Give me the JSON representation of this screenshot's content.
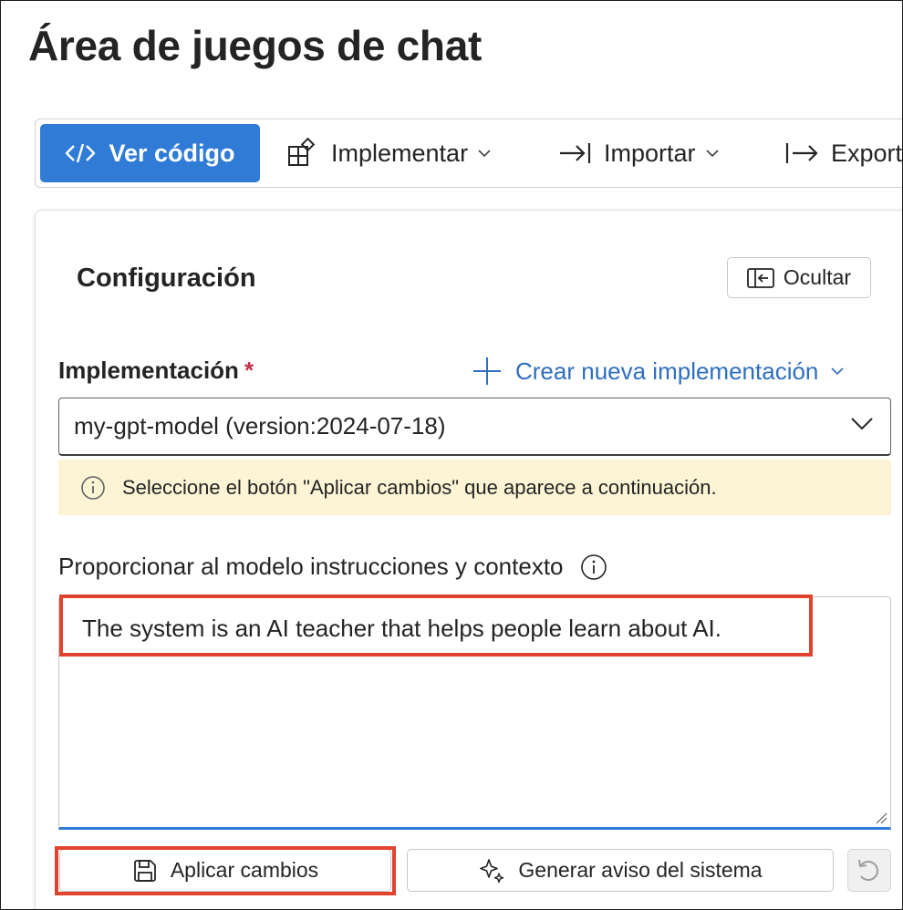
{
  "page": {
    "title": "Área de juegos de chat"
  },
  "toolbar": {
    "view_code": "Ver código",
    "deploy": "Implementar",
    "import": "Importar",
    "export": "Export"
  },
  "config": {
    "title": "Configuración",
    "hide_label": "Ocultar",
    "deployment_label": "Implementación",
    "required_mark": "*",
    "create_link": "Crear nueva implementación",
    "deployment_value": "my-gpt-model (version:2024-07-18)",
    "notice_text": "Seleccione el botón \"Aplicar cambios\" que aparece a continuación.",
    "instructions_label": "Proporcionar al modelo instrucciones y contexto",
    "system_message": "The system is an AI teacher that helps people learn about AI.",
    "apply_label": "Aplicar cambios",
    "generate_label": "Generar aviso del sistema"
  },
  "colors": {
    "primary": "#2f7bd6",
    "link": "#2f6fbf",
    "notice_bg": "#fcf4d4",
    "highlight_box": "#e0442f",
    "required": "#c4314b"
  },
  "icons": [
    "code-icon",
    "deploy-icon",
    "import-icon",
    "export-icon",
    "chevron-down-icon",
    "panel-collapse-icon",
    "plus-icon",
    "info-icon",
    "save-icon",
    "sparkle-icon",
    "undo-icon",
    "resize-grip-icon"
  ]
}
